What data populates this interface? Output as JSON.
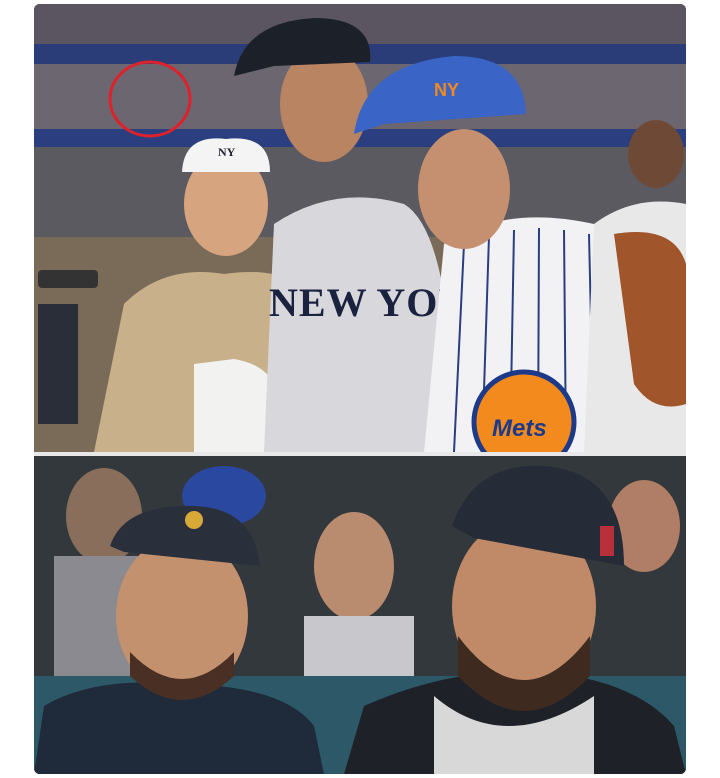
{
  "image": {
    "top_panel": {
      "jersey_text": "NEW YORK",
      "cap_logo_ny": "NY",
      "patch_text": "Mets"
    },
    "bottom_panel": {}
  }
}
